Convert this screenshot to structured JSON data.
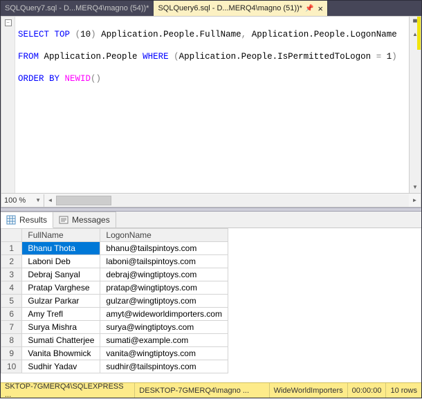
{
  "tabs": [
    {
      "label": "SQLQuery7.sql - D...MERQ4\\magno (54))*",
      "active": false
    },
    {
      "label": "SQLQuery6.sql - D...MERQ4\\magno (51))*",
      "active": true
    }
  ],
  "sql": {
    "line1": {
      "select": "SELECT",
      "top": "TOP",
      "paren_open": "(",
      "n": "10",
      "paren_close": ")",
      "col1": "Application.People.FullName",
      "comma": ",",
      "col2": "Application.People.LogonName"
    },
    "line2": {
      "from": "FROM",
      "tbl": "Application.People",
      "where": "WHERE",
      "po": "(",
      "colcond": "Application.People.IsPermittedToLogon",
      "eq": "=",
      "one_spaced": " 1",
      "pc": ")"
    },
    "line3": {
      "orderby": "ORDER BY",
      "newid": "NEWID",
      "parens": "()"
    }
  },
  "zoom": "100 %",
  "results_tabs": {
    "results": "Results",
    "messages": "Messages"
  },
  "columns": {
    "fullname": "FullName",
    "logonname": "LogonName"
  },
  "rows": [
    {
      "n": "1",
      "FullName": "Bhanu Thota",
      "LogonName": "bhanu@tailspintoys.com"
    },
    {
      "n": "2",
      "FullName": "Laboni Deb",
      "LogonName": "laboni@tailspintoys.com"
    },
    {
      "n": "3",
      "FullName": "Debraj Sanyal",
      "LogonName": "debraj@wingtiptoys.com"
    },
    {
      "n": "4",
      "FullName": "Pratap Varghese",
      "LogonName": "pratap@wingtiptoys.com"
    },
    {
      "n": "5",
      "FullName": "Gulzar Parkar",
      "LogonName": "gulzar@wingtiptoys.com"
    },
    {
      "n": "6",
      "FullName": "Amy Trefl",
      "LogonName": "amyt@wideworldimporters.com"
    },
    {
      "n": "7",
      "FullName": "Surya Mishra",
      "LogonName": "surya@wingtiptoys.com"
    },
    {
      "n": "8",
      "FullName": "Sumati Chatterjee",
      "LogonName": "sumati@example.com"
    },
    {
      "n": "9",
      "FullName": "Vanita Bhowmick",
      "LogonName": "vanita@wingtiptoys.com"
    },
    {
      "n": "10",
      "FullName": "Sudhir Yadav",
      "LogonName": "sudhir@tailspintoys.com"
    }
  ],
  "status": {
    "server": "SKTOP-7GMERQ4\\SQLEXPRESS ...",
    "user": "DESKTOP-7GMERQ4\\magno ...",
    "db": "WideWorldImporters",
    "elapsed": "00:00:00",
    "rows": "10 rows"
  }
}
